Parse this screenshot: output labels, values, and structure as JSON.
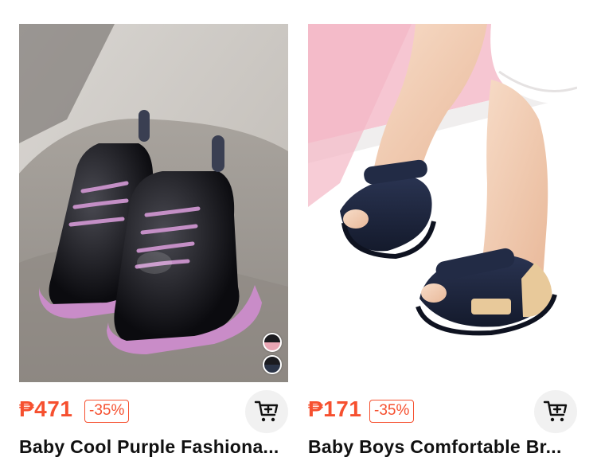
{
  "products": [
    {
      "price": "₱471",
      "discount": "-35%",
      "title": "Baby Cool Purple Fashiona...",
      "image_icon": "boots-image",
      "swatch_colors": [
        "#e9a6b4",
        "#2b3447"
      ]
    },
    {
      "price": "₱171",
      "discount": "-35%",
      "title": "Baby Boys Comfortable Br...",
      "image_icon": "sandals-image"
    }
  ],
  "colors": {
    "accent": "#f6502f",
    "cart_button_bg": "#f1f1f1"
  },
  "icons": {
    "cart": "add-to-cart-icon"
  }
}
